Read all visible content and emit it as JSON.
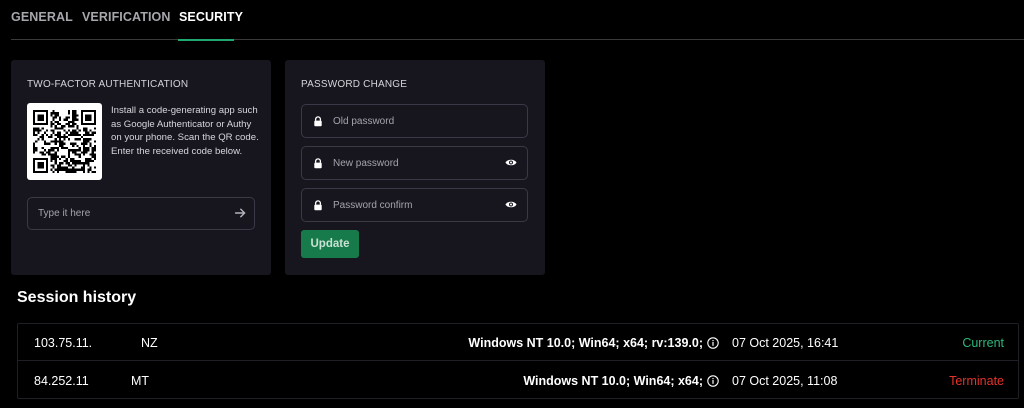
{
  "tabs": [
    {
      "label": "GENERAL",
      "active": false
    },
    {
      "label": "VERIFICATION",
      "active": false
    },
    {
      "label": "SECURITY",
      "active": true
    }
  ],
  "two_factor": {
    "title": "TWO-FACTOR AUTHENTICATION",
    "instructions": "Install a code-generating app such as Google Authenticator or Authy on your phone. Scan the QR code. Enter the received code below.",
    "code_placeholder": "Type it here"
  },
  "password_change": {
    "title": "PASSWORD CHANGE",
    "old_placeholder": "Old password",
    "new_placeholder": "New password",
    "confirm_placeholder": "Password confirm",
    "update_label": "Update"
  },
  "session_history": {
    "title": "Session history",
    "rows": [
      {
        "ip": "103.75.11.",
        "country": "NZ",
        "agent": "Windows NT 10.0; Win64; x64; rv:139.0;",
        "date": "07 Oct 2025, 16:41",
        "status": "Current"
      },
      {
        "ip": "84.252.11",
        "country": "MT",
        "agent": "Windows NT 10.0; Win64; x64;",
        "date": "07 Oct 2025, 11:08",
        "status": "Terminate"
      }
    ]
  },
  "colors": {
    "accent": "#1fa870",
    "card_bg": "#17161f",
    "current": "#2cb87a",
    "terminate": "#e5322b"
  },
  "icons": [
    "lock-icon",
    "eye-icon",
    "arrow-right-icon",
    "info-icon",
    "qr-code"
  ]
}
